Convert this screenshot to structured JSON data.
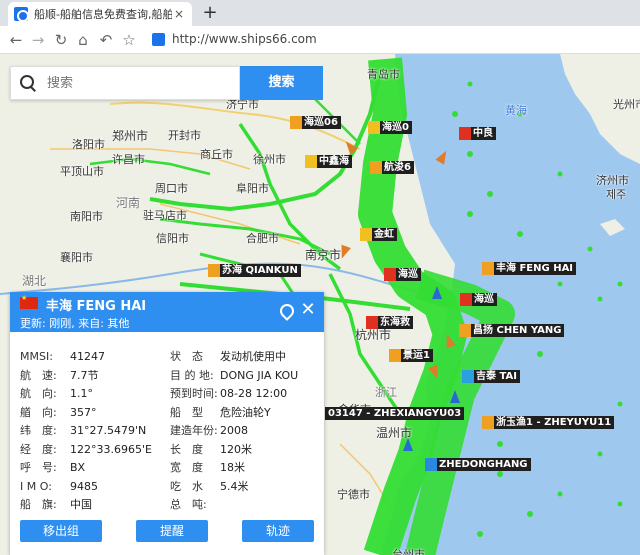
{
  "browser": {
    "tab_title": "船顺-船舶信息免费查询,船舶动态",
    "tab_close": "×",
    "new_tab": "+",
    "url": "http://www.ships66.com"
  },
  "search": {
    "placeholder": "搜索",
    "button": "搜索"
  },
  "map": {
    "cities": [
      {
        "name": "青岛市"
      },
      {
        "name": "济宁市"
      },
      {
        "name": "郑州市"
      },
      {
        "name": "开封市"
      },
      {
        "name": "商丘市"
      },
      {
        "name": "徐州市"
      },
      {
        "name": "洛阳市"
      },
      {
        "name": "许昌市"
      },
      {
        "name": "平顶山市"
      },
      {
        "name": "周口市"
      },
      {
        "name": "阜阳市"
      },
      {
        "name": "河南"
      },
      {
        "name": "驻马店市"
      },
      {
        "name": "南阳市"
      },
      {
        "name": "信阳市"
      },
      {
        "name": "襄阳市"
      },
      {
        "name": "湖北"
      },
      {
        "name": "合肥市"
      },
      {
        "name": "南京市"
      },
      {
        "name": "杭州市"
      },
      {
        "name": "浙江"
      },
      {
        "name": "金华市"
      },
      {
        "name": "温州市"
      },
      {
        "name": "宁德市"
      },
      {
        "name": "台州市"
      },
      {
        "name": "光州市"
      },
      {
        "name": "济州市"
      },
      {
        "name": "제주"
      },
      {
        "name": "黄海"
      }
    ],
    "ships": [
      {
        "label": "海巡06",
        "color": "#f0a020"
      },
      {
        "label": "海巡0",
        "color": "#f0c020"
      },
      {
        "label": "中良",
        "color": "#e03020"
      },
      {
        "label": "中鑫海",
        "color": "#f0c020"
      },
      {
        "label": "航浚6",
        "color": "#f0a020"
      },
      {
        "label": "金虹",
        "color": "#f0c020"
      },
      {
        "label": "苏海 QIANKUN",
        "color": "#f0a020"
      },
      {
        "label": "海巡",
        "color": "#e03020"
      },
      {
        "label": "丰海 FENG HAI",
        "color": "#f0a020"
      },
      {
        "label": "海巡",
        "color": "#e03020"
      },
      {
        "label": "东海救",
        "color": "#e03020"
      },
      {
        "label": "昌扬 CHEN YANG",
        "color": "#f0a020"
      },
      {
        "label": "景运1",
        "color": "#f0a020"
      },
      {
        "label": "吉泰 TAI",
        "color": "#2aa0e0"
      },
      {
        "label": "03147 - ZHEXIANGYU03",
        "color": "#f0a020"
      },
      {
        "label": "浙玉渔1 - ZHEYUYU11",
        "color": "#f0a020"
      },
      {
        "label": "ZHEDONGHANG",
        "color": "#2a88e0"
      }
    ]
  },
  "panel": {
    "name": "丰海 FENG HAI",
    "update": "更新: 刚刚, 来自: 其他",
    "rows": [
      [
        {
          "k": "MMSI:",
          "v": "41247"
        },
        {
          "k": "状　态",
          "v": "发动机使用中"
        }
      ],
      [
        {
          "k": "航　速:",
          "v": "7.7节"
        },
        {
          "k": "目 的 地:",
          "v": "DONG JIA KOU"
        }
      ],
      [
        {
          "k": "航　向:",
          "v": "1.1°"
        },
        {
          "k": "预到时间:",
          "v": "08-28 12:00"
        }
      ],
      [
        {
          "k": "艏　向:",
          "v": "357°"
        },
        {
          "k": "船　型",
          "v": "危险油轮Y"
        }
      ],
      [
        {
          "k": "纬　度:",
          "v": "31°27.5479'N"
        },
        {
          "k": "建造年份:",
          "v": "2008"
        }
      ],
      [
        {
          "k": "经　度:",
          "v": "122°33.6965'E"
        },
        {
          "k": "长　度",
          "v": "120米"
        }
      ],
      [
        {
          "k": "呼　号:",
          "v": "BX"
        },
        {
          "k": "宽　度",
          "v": "18米"
        }
      ],
      [
        {
          "k": "I M O:",
          "v": "9485"
        },
        {
          "k": "吃　水",
          "v": "5.4米"
        }
      ],
      [
        {
          "k": "船　旗:",
          "v": "中国"
        },
        {
          "k": "总　吨:",
          "v": ""
        }
      ]
    ],
    "buttons": {
      "remove": "移出组",
      "remind": "提醒",
      "track": "轨迹"
    }
  }
}
